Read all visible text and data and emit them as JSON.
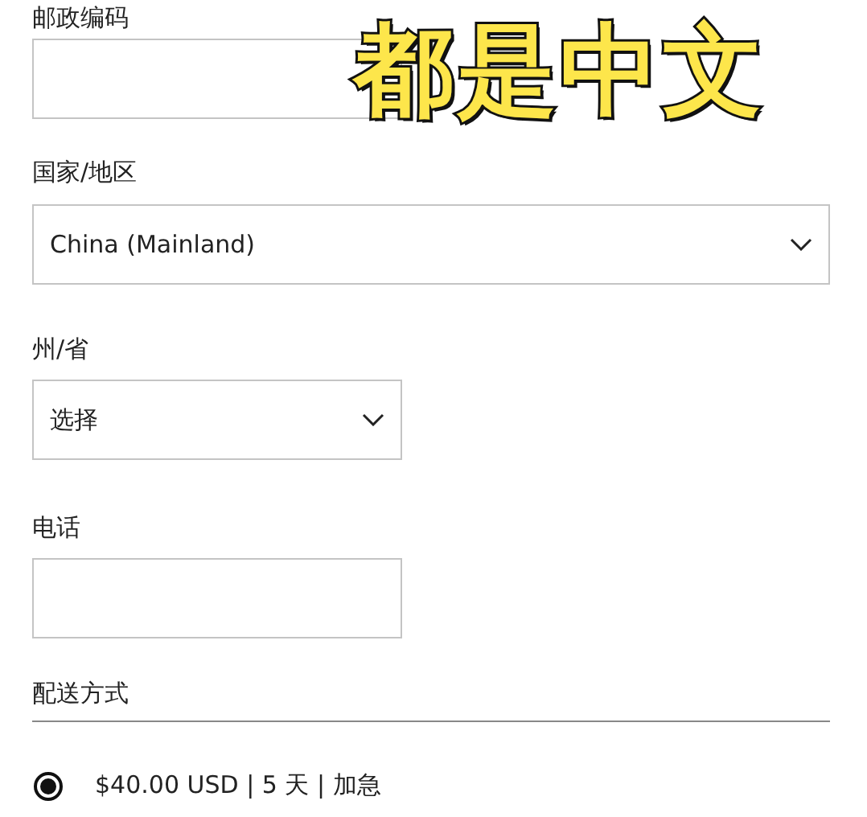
{
  "postal_code": {
    "label": "邮政编码"
  },
  "caption": "都是中文",
  "country": {
    "label": "国家/地区",
    "value": "China (Mainland)"
  },
  "state": {
    "label": "州/省",
    "value": "选择"
  },
  "phone": {
    "label": "电话"
  },
  "shipping": {
    "label": "配送方式",
    "options": [
      {
        "text": "$40.00 USD | 5 天 | 加急",
        "selected": true
      }
    ]
  }
}
